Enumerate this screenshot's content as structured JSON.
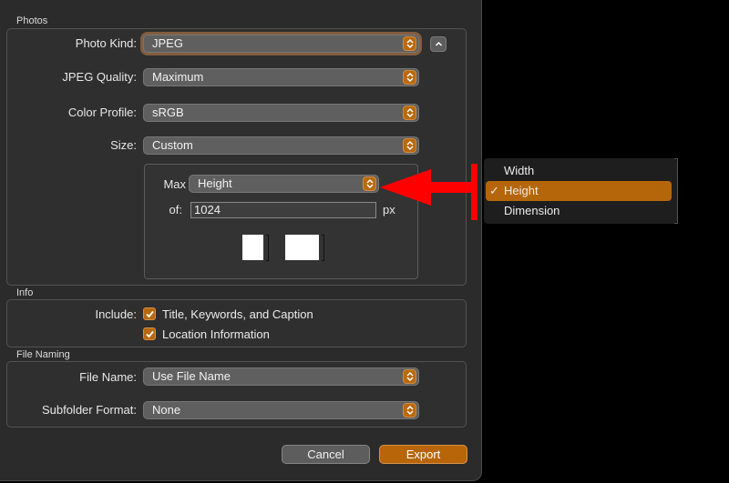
{
  "photos": {
    "section_title": "Photos",
    "photo_kind": {
      "label": "Photo Kind:",
      "value": "JPEG"
    },
    "jpeg_quality": {
      "label": "JPEG Quality:",
      "value": "Maximum"
    },
    "color_profile": {
      "label": "Color Profile:",
      "value": "sRGB"
    },
    "size": {
      "label": "Size:",
      "value": "Custom"
    },
    "custom_size": {
      "max_label": "Max",
      "max_value": "Height",
      "of_label": "of:",
      "of_value": "1024",
      "unit": "px"
    }
  },
  "info": {
    "section_title": "Info",
    "include_label": "Include:",
    "checkboxes": [
      {
        "label": "Title, Keywords, and Caption",
        "checked": true
      },
      {
        "label": "Location Information",
        "checked": true
      }
    ]
  },
  "file_naming": {
    "section_title": "File Naming",
    "file_name": {
      "label": "File Name:",
      "value": "Use File Name"
    },
    "subfolder_format": {
      "label": "Subfolder Format:",
      "value": "None"
    }
  },
  "buttons": {
    "cancel": "Cancel",
    "export": "Export"
  },
  "dropdown_menu": {
    "items": [
      {
        "label": "Width",
        "selected": false
      },
      {
        "label": "Height",
        "selected": true
      },
      {
        "label": "Dimension",
        "selected": false
      }
    ],
    "check_glyph": "✓"
  },
  "colors": {
    "accent": "#b8650a",
    "annotation": "#ff0000"
  }
}
